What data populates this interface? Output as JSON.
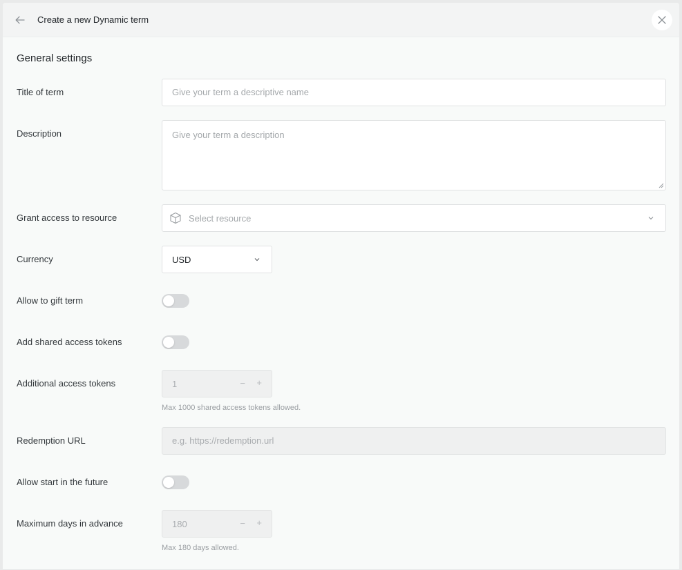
{
  "header": {
    "title": "Create a new Dynamic term"
  },
  "section_title": "General settings",
  "fields": {
    "title": {
      "label": "Title of term",
      "placeholder": "Give your term a descriptive name"
    },
    "description": {
      "label": "Description",
      "placeholder": "Give your term a description"
    },
    "resource": {
      "label": "Grant access to resource",
      "placeholder": "Select resource"
    },
    "currency": {
      "label": "Currency",
      "value": "USD"
    },
    "gift": {
      "label": "Allow to gift term",
      "enabled": false
    },
    "shared_tokens": {
      "label": "Add shared access tokens",
      "enabled": false
    },
    "additional_tokens": {
      "label": "Additional access tokens",
      "value": "1",
      "minus": "−",
      "plus": "+",
      "hint": "Max 1000 shared access tokens allowed."
    },
    "redemption_url": {
      "label": "Redemption URL",
      "placeholder": "e.g. https://redemption.url"
    },
    "future_start": {
      "label": "Allow start in the future",
      "enabled": false
    },
    "max_days": {
      "label": "Maximum days in advance",
      "value": "180",
      "minus": "−",
      "plus": "+",
      "hint": "Max 180 days allowed."
    }
  },
  "icons": {
    "back": "arrow-left-icon",
    "close": "close-icon",
    "resource": "cube-icon",
    "dropdown": "chevron-down-icon"
  },
  "colors": {
    "background": "#f8faf9",
    "header": "#f3f4f4",
    "toggle_off": "#d7d9db",
    "disabled_input": "#eff0f0"
  }
}
